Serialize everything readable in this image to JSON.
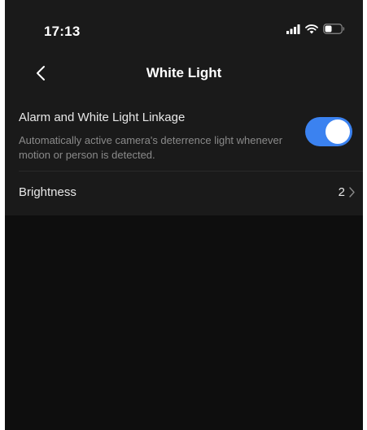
{
  "status_bar": {
    "time": "17:13",
    "icons": [
      "signal-icon",
      "wifi-icon",
      "battery-icon"
    ]
  },
  "nav": {
    "back_icon": "chevron-left-icon",
    "title": "White Light"
  },
  "settings": {
    "linkage": {
      "title": "Alarm and White Light Linkage",
      "description": "Automatically active camera's deterrence light whenever motion or person is detected.",
      "enabled": true
    },
    "brightness": {
      "label": "Brightness",
      "value": "2",
      "icon": "chevron-right-icon"
    }
  },
  "colors": {
    "background": "#0e0e0e",
    "panel": "#1a1a1a",
    "accent": "#3b82f0",
    "text_primary": "#e8e8e8",
    "text_secondary": "#8a8a8a"
  }
}
